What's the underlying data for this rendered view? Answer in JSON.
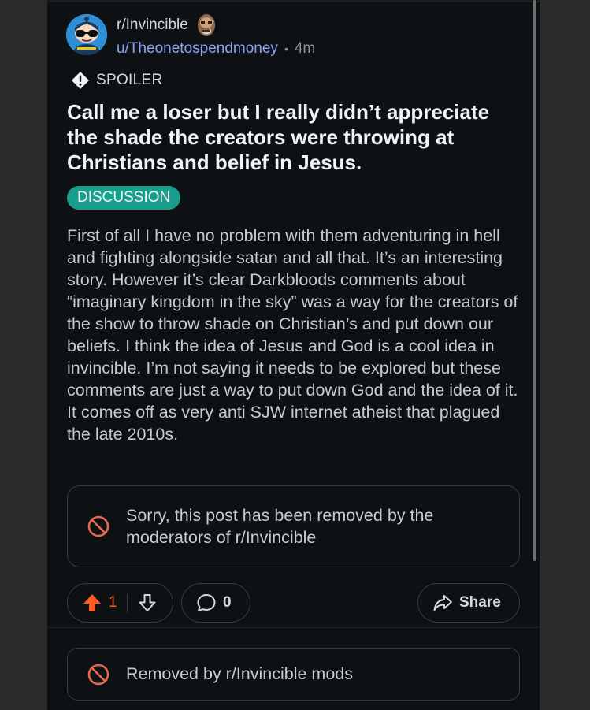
{
  "post": {
    "subreddit": "r/Invincible",
    "author": "u/Theonetospendmoney",
    "separator": "•",
    "age": "4m",
    "spoiler_label": "SPOILER",
    "title": "Call me a loser but I really didn’t appreciate the shade the creators were throwing at Christians and belief in Jesus.",
    "flair": "DISCUSSION",
    "body": "First of all I have no problem with them adventuring in hell and fighting alongside satan and all that. It’s an interesting story. However it’s clear Darkbloods comments about “imaginary kingdom in the sky” was a way for the creators of the show to throw shade on Christian’s and put down our beliefs. I think the idea of Jesus and God is a cool idea in invincible. I’m not saying it needs to be explored but these comments are just a way to put down God and the idea of it. It comes off as very anti SJW internet atheist that plagued the late 2010s.",
    "removed_notice": "Sorry, this post has been removed by the moderators of r/Invincible"
  },
  "actions": {
    "vote_count": "1",
    "comment_count": "0",
    "share_label": "Share"
  },
  "comment": {
    "removed_notice": "Removed by r/Invincible mods"
  },
  "icons": {
    "avatar": "snoo-avatar-icon",
    "subreddit": "subreddit-icon",
    "spoiler": "warning-icon",
    "removed": "ban-icon",
    "upvote": "upvote-arrow-icon",
    "downvote": "downvote-arrow-icon",
    "comment": "comment-bubble-icon",
    "share": "share-arrow-icon"
  },
  "colors": {
    "background": "#0e1113",
    "username": "#8aa3f5",
    "flair": "#1a9e8c",
    "upvote_active": "#ff5a1f",
    "ban": "#e8694a"
  }
}
